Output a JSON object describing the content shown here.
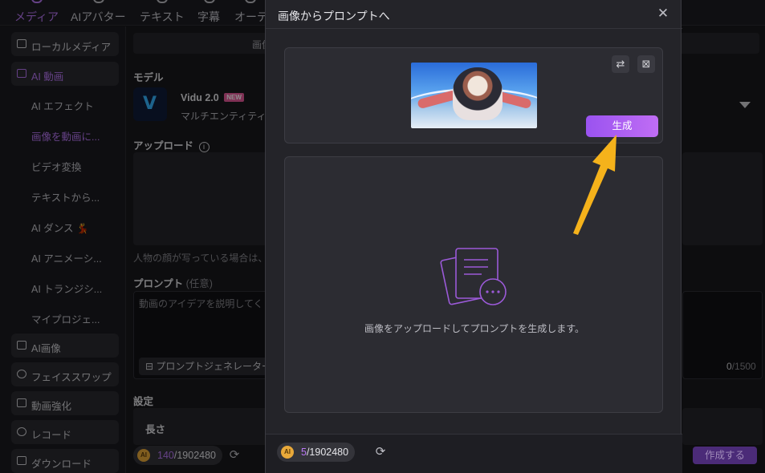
{
  "tabs": [
    {
      "label": "メディア",
      "active": true
    },
    {
      "label": "AIアバター"
    },
    {
      "label": "テキスト"
    },
    {
      "label": "字幕"
    },
    {
      "label": "オーデ"
    }
  ],
  "sidebar": {
    "items": [
      {
        "label": "ローカルメディア",
        "icon": "folder-icon"
      },
      {
        "label": "AI 動画",
        "icon": "ai-video-icon",
        "active": true
      },
      {
        "label": "AI エフェクト",
        "sub": true
      },
      {
        "label": "画像を動画に...",
        "sub": true,
        "active": true
      },
      {
        "label": "ビデオ変換",
        "sub": true
      },
      {
        "label": "テキストから...",
        "sub": true
      },
      {
        "label": "AI ダンス 💃",
        "sub": true
      },
      {
        "label": "AI アニメーシ...",
        "sub": true
      },
      {
        "label": "AI トランジシ...",
        "sub": true
      },
      {
        "label": "マイプロジェ...",
        "sub": true
      },
      {
        "label": "AI画像",
        "icon": "ai-image-icon"
      },
      {
        "label": "フェイススワップ",
        "icon": "face-swap-icon"
      },
      {
        "label": "動画強化",
        "icon": "enhance-icon"
      },
      {
        "label": "レコード",
        "icon": "record-icon"
      },
      {
        "label": "ダウンロード",
        "icon": "download-icon"
      }
    ]
  },
  "main": {
    "top_pill": "画像",
    "model_label": "モデル",
    "model_name": "Vidu 2.0",
    "model_badge": "NEW",
    "model_desc": "マルチエンティティ",
    "upload_label": "アップロード",
    "upload_hint": "人物の顔が写っている場合は、",
    "prompt_label": "プロンプト",
    "prompt_optional": "(任意)",
    "prompt_placeholder": "動画のアイデアを説明してく",
    "prompt_generator": "プロンプトジェネレーター",
    "char_count": "0",
    "char_max": "/1500",
    "settings_label": "設定",
    "length_label": "長さ",
    "credits_used": "140",
    "credits_total": "/1902480",
    "create_button": "作成する"
  },
  "modal": {
    "title": "画像からプロンプトへ",
    "generate_button": "生成",
    "empty_text": "画像をアップロードしてプロンプトを生成します。",
    "credits_used": "5",
    "credits_total": "/1902480",
    "coin_label": "AI"
  },
  "colors": {
    "accent": "#b877f5",
    "button_gradient_start": "#9a53f0",
    "button_gradient_end": "#c06df4",
    "arrow": "#f5b21b"
  }
}
